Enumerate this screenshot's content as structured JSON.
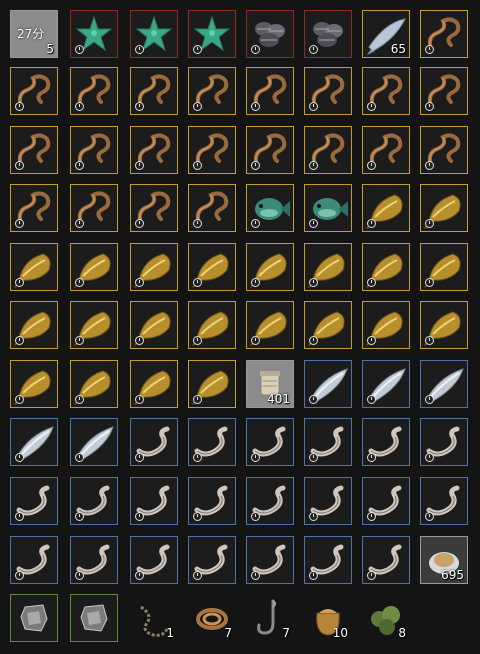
{
  "inventory": {
    "top_left_slot": {
      "label": "27分",
      "count": "5"
    },
    "rows": [
      [
        {
          "item": "timer-slot",
          "border": "gray"
        },
        {
          "item": "starfish",
          "border": "red",
          "timer": true
        },
        {
          "item": "starfish",
          "border": "red",
          "timer": true
        },
        {
          "item": "starfish",
          "border": "red",
          "timer": true
        },
        {
          "item": "clam-pile",
          "border": "red",
          "timer": true
        },
        {
          "item": "clam-pile",
          "border": "red",
          "timer": true
        },
        {
          "item": "sardine",
          "border": "gold",
          "count": "65"
        },
        {
          "item": "worm-rope",
          "border": "gold",
          "timer": true
        }
      ],
      [
        {
          "item": "worm-rope",
          "border": "gold",
          "timer": true
        },
        {
          "item": "worm-rope",
          "border": "gold",
          "timer": true
        },
        {
          "item": "worm-rope",
          "border": "gold",
          "timer": true
        },
        {
          "item": "worm-rope",
          "border": "gold",
          "timer": true
        },
        {
          "item": "worm-rope",
          "border": "gold",
          "timer": true
        },
        {
          "item": "worm-rope",
          "border": "gold",
          "timer": true
        },
        {
          "item": "worm-rope",
          "border": "gold",
          "timer": true
        },
        {
          "item": "worm-rope",
          "border": "gold",
          "timer": true
        }
      ],
      [
        {
          "item": "worm-rope",
          "border": "gold",
          "timer": true
        },
        {
          "item": "worm-rope",
          "border": "gold",
          "timer": true
        },
        {
          "item": "worm-rope",
          "border": "gold",
          "timer": true
        },
        {
          "item": "worm-rope",
          "border": "gold",
          "timer": true
        },
        {
          "item": "worm-rope",
          "border": "gold",
          "timer": true
        },
        {
          "item": "worm-rope",
          "border": "gold",
          "timer": true
        },
        {
          "item": "worm-rope",
          "border": "gold",
          "timer": true
        },
        {
          "item": "worm-rope",
          "border": "gold",
          "timer": true
        }
      ],
      [
        {
          "item": "worm-rope",
          "border": "gold",
          "timer": true
        },
        {
          "item": "worm-rope",
          "border": "gold",
          "timer": true
        },
        {
          "item": "worm-rope",
          "border": "gold",
          "timer": true
        },
        {
          "item": "worm-rope",
          "border": "gold",
          "timer": true
        },
        {
          "item": "green-fish",
          "border": "gold",
          "timer": true
        },
        {
          "item": "green-fish",
          "border": "gold",
          "timer": true
        },
        {
          "item": "golden-fish",
          "border": "gold",
          "timer": true
        },
        {
          "item": "golden-fish",
          "border": "gold",
          "timer": true
        }
      ],
      [
        {
          "item": "golden-fish",
          "border": "gold",
          "timer": true
        },
        {
          "item": "golden-fish",
          "border": "gold",
          "timer": true
        },
        {
          "item": "golden-fish",
          "border": "gold",
          "timer": true
        },
        {
          "item": "golden-fish",
          "border": "gold",
          "timer": true
        },
        {
          "item": "golden-fish",
          "border": "gold",
          "timer": true
        },
        {
          "item": "golden-fish",
          "border": "gold",
          "timer": true
        },
        {
          "item": "golden-fish",
          "border": "gold",
          "timer": true
        },
        {
          "item": "golden-fish",
          "border": "gold",
          "timer": true
        }
      ],
      [
        {
          "item": "golden-fish",
          "border": "gold",
          "timer": true
        },
        {
          "item": "golden-fish",
          "border": "gold",
          "timer": true
        },
        {
          "item": "golden-fish",
          "border": "gold",
          "timer": true
        },
        {
          "item": "golden-fish",
          "border": "gold",
          "timer": true
        },
        {
          "item": "golden-fish",
          "border": "gold",
          "timer": true
        },
        {
          "item": "golden-fish",
          "border": "gold",
          "timer": true
        },
        {
          "item": "golden-fish",
          "border": "gold",
          "timer": true
        },
        {
          "item": "golden-fish",
          "border": "gold",
          "timer": true
        }
      ],
      [
        {
          "item": "golden-fish",
          "border": "gold",
          "timer": true
        },
        {
          "item": "golden-fish",
          "border": "gold",
          "timer": true
        },
        {
          "item": "golden-fish",
          "border": "gold",
          "timer": true
        },
        {
          "item": "golden-fish",
          "border": "gold",
          "timer": true
        },
        {
          "item": "bait-jar",
          "border": "gray",
          "count": "401"
        },
        {
          "item": "silver-fish",
          "border": "blue",
          "timer": true
        },
        {
          "item": "silver-fish",
          "border": "blue",
          "timer": true
        },
        {
          "item": "silver-fish",
          "border": "blue",
          "timer": true
        }
      ],
      [
        {
          "item": "silver-fish",
          "border": "blue",
          "timer": true
        },
        {
          "item": "silver-fish",
          "border": "blue",
          "timer": true
        },
        {
          "item": "eel",
          "border": "blue",
          "timer": true
        },
        {
          "item": "eel",
          "border": "blue",
          "timer": true
        },
        {
          "item": "eel",
          "border": "blue",
          "timer": true
        },
        {
          "item": "eel",
          "border": "blue",
          "timer": true
        },
        {
          "item": "eel",
          "border": "blue",
          "timer": true
        },
        {
          "item": "eel",
          "border": "blue",
          "timer": true
        }
      ],
      [
        {
          "item": "eel",
          "border": "blue",
          "timer": true
        },
        {
          "item": "eel",
          "border": "blue",
          "timer": true
        },
        {
          "item": "eel",
          "border": "blue",
          "timer": true
        },
        {
          "item": "eel",
          "border": "blue",
          "timer": true
        },
        {
          "item": "eel",
          "border": "blue",
          "timer": true
        },
        {
          "item": "eel",
          "border": "blue",
          "timer": true
        },
        {
          "item": "eel",
          "border": "blue",
          "timer": true
        },
        {
          "item": "eel",
          "border": "blue",
          "timer": true
        }
      ],
      [
        {
          "item": "eel",
          "border": "blue",
          "timer": true
        },
        {
          "item": "eel",
          "border": "blue",
          "timer": true
        },
        {
          "item": "eel",
          "border": "blue",
          "timer": true
        },
        {
          "item": "eel",
          "border": "blue",
          "timer": true
        },
        {
          "item": "eel",
          "border": "blue",
          "timer": true
        },
        {
          "item": "eel",
          "border": "blue",
          "timer": true
        },
        {
          "item": "eel",
          "border": "blue",
          "timer": true
        },
        {
          "item": "bait-bowl",
          "border": "dark",
          "count": "695"
        }
      ],
      [
        {
          "item": "ore-chunk",
          "border": "green"
        },
        {
          "item": "ore-chunk",
          "border": "green"
        },
        {
          "item": "chain-rope",
          "border": "none",
          "count": "1"
        },
        {
          "item": "coiled-rope",
          "border": "none",
          "count": "7"
        },
        {
          "item": "fishing-hook",
          "border": "none",
          "count": "7"
        },
        {
          "item": "bait-sack",
          "border": "none",
          "count": "10"
        },
        {
          "item": "seaweed",
          "border": "none",
          "count": "8"
        },
        {
          "item": "empty",
          "border": "none"
        }
      ]
    ]
  },
  "colors": {
    "gold-border": "#c59a2f",
    "blue-border": "#4d74a8",
    "red-border": "#8e2a22",
    "green-border": "#5a8a3a"
  }
}
